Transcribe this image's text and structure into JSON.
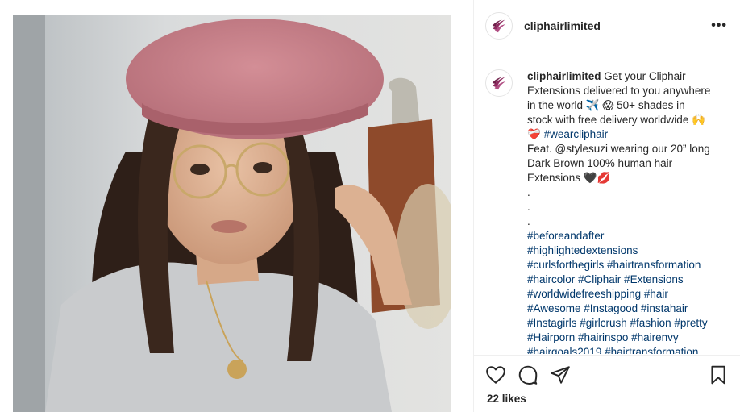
{
  "post": {
    "username": "cliphairlimited",
    "more_label": "•••",
    "likes_text": "22 likes"
  },
  "caption": {
    "username": "cliphairlimited",
    "line1": "Get your Cliphair",
    "line2": "Extensions delivered to you anywhere",
    "line3": "in the world ✈️ 😱 50+ shades in",
    "line4": "stock with free delivery worldwide 🙌",
    "line5_emoji": "❤️‍🩹",
    "line5_tag": "#wearcliphair",
    "line6": "Feat. @stylesuzi wearing our 20” long",
    "line7": "Dark Brown 100% human hair",
    "line8": "Extensions 🖤💋",
    "dots": [
      ".",
      ".",
      "."
    ],
    "hashtag_lines": [
      "#beforeandafter",
      "#highlightedextensions",
      "#curlsforthegirls #hairtransformation",
      "#haircolor #Cliphair #Extensions",
      "#worldwidefreeshipping #hair",
      "#Awesome #Instagood #instahair",
      "#Instagirls #girlcrush #fashion #pretty",
      "#Hairporn #hairinspo #hairenvy",
      "#hairgoals2019 #hairtransformation"
    ]
  },
  "icons": {
    "like": "heart-icon",
    "comment": "comment-icon",
    "share": "paper-plane-icon",
    "save": "bookmark-icon"
  },
  "colors": {
    "hashtag": "#00376b",
    "brand_logo": "#8e2a5f",
    "text": "#262626"
  }
}
